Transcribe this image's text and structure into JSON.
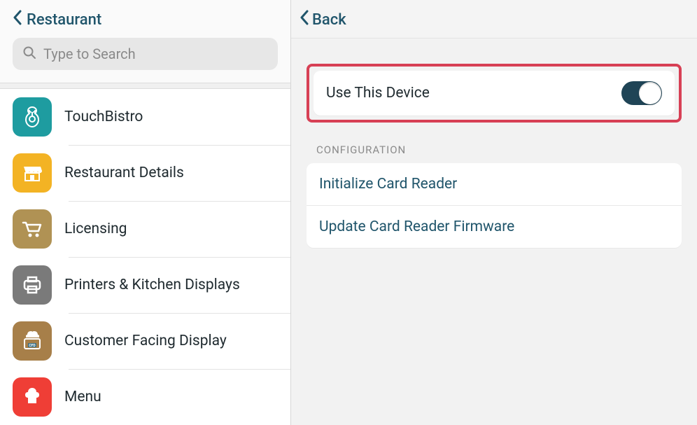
{
  "sidebar": {
    "back_label": "Restaurant",
    "search_placeholder": "Type to Search",
    "items": [
      {
        "label": "TouchBistro",
        "icon": "touchbistro-icon",
        "bg": "#1e9ca0",
        "fg": "#ffffff"
      },
      {
        "label": "Restaurant Details",
        "icon": "storefront-icon",
        "bg": "#f3b324",
        "fg": "#ffffff"
      },
      {
        "label": "Licensing",
        "icon": "cart-icon",
        "bg": "#b09254",
        "fg": "#ffffff"
      },
      {
        "label": "Printers & Kitchen Displays",
        "icon": "printer-icon",
        "bg": "#7a7a7a",
        "fg": "#ffffff"
      },
      {
        "label": "Customer Facing Display",
        "icon": "cfd-icon",
        "bg": "#a77f49",
        "fg": "#ffffff"
      },
      {
        "label": "Menu",
        "icon": "chef-icon",
        "bg": "#ef3e36",
        "fg": "#ffffff"
      }
    ]
  },
  "main": {
    "back_label": "Back",
    "toggle": {
      "label": "Use This Device",
      "value": true
    },
    "config_section_label": "CONFIGURATION",
    "config_items": [
      {
        "label": "Initialize Card Reader"
      },
      {
        "label": "Update Card Reader Firmware"
      }
    ]
  },
  "colors": {
    "link": "#20556b",
    "highlight_border": "#d74055"
  }
}
